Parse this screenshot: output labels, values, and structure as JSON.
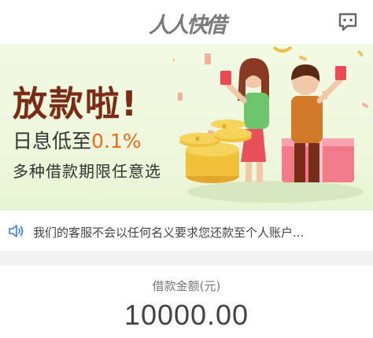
{
  "header": {
    "title": "人人快借",
    "service_icon": "chat-bubble-icon"
  },
  "banner": {
    "headline": "放款啦!",
    "rate_prefix": "日息低至",
    "rate_value": "0.1%",
    "subtitle": "多种借款期限任意选"
  },
  "notice": {
    "icon": "speaker-icon",
    "text": "我们的客服不会以任何名义要求您还款至个人账户..."
  },
  "loan": {
    "label": "借款金额(元)",
    "amount": "10000.00"
  },
  "colors": {
    "headline": "#7a2c16",
    "rate_highlight": "#f06a1e",
    "banner_bg": "#f3fae3",
    "title_gray": "#7a7a7a"
  }
}
